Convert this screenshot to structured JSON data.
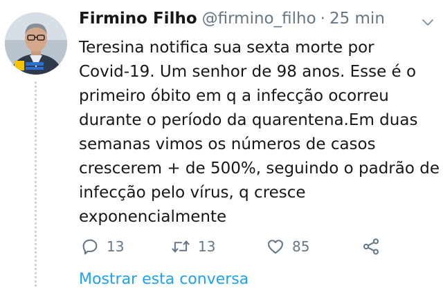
{
  "tweet": {
    "display_name": "Firmino Filho",
    "handle": "@firmino_filho",
    "separator": "·",
    "time": "25 min",
    "lines": [
      "Teresina notifica sua sexta morte por",
      "Covid-19. Um senhor de 98 anos. Esse é o",
      "primeiro óbito em q a infecção ocorreu",
      "durante o período da quarentena.Em duas",
      "semanas vimos os números de casos",
      "crescerem + de 500%, seguindo o padrão de",
      "infecção pelo vírus, q cresce",
      "exponencialmente"
    ],
    "replies": "13",
    "retweets": "13",
    "likes": "85",
    "show_thread": "Mostrar esta conversa"
  },
  "colors": {
    "text": "#14171a",
    "muted": "#657786",
    "link": "#1da1f2",
    "thread_line": "#c9d3dc"
  },
  "icons": [
    "chevron-down-icon",
    "reply-icon",
    "retweet-icon",
    "like-icon",
    "share-icon"
  ]
}
